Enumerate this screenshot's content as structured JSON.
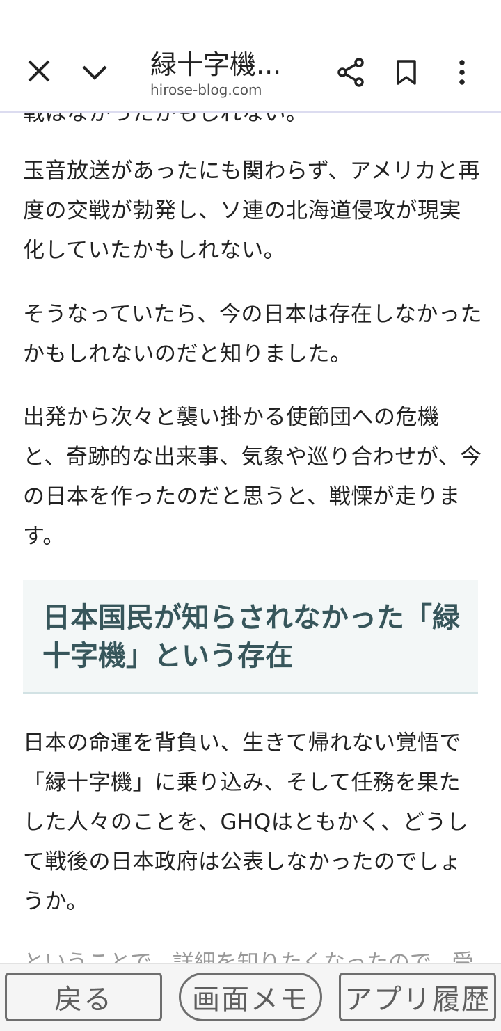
{
  "toolbar": {
    "title": "緑十字機...",
    "url": "hirose-blog.com",
    "icons": [
      "close-icon",
      "chevron-down-icon",
      "share-icon",
      "bookmark-icon",
      "more-vert-icon"
    ]
  },
  "article": {
    "top_fragment": "戦はなかったかもしれない。",
    "paragraphs": [
      "玉音放送があったにも関わらず、アメリカと再度の交戦が勃発し、ソ連の北海道侵攻が現実化していたかもしれない。",
      "そうなっていたら、今の日本は存在しなかったかもしれないのだと知りました。",
      "出発から次々と襲い掛かる使節団への危機と、奇跡的な出来事、気象や巡り合わせが、今の日本を作ったのだと思うと、戦慄が走ります。"
    ],
    "heading": "日本国民が知らされなかった「緑十字機」という存在",
    "paragraph_after": "日本の命運を背負い、生きて帰れない覚悟で「緑十字機」に乗り込み、そして任務を果たした人々のことを、GHQはともかく、どうして戦後の日本政府は公表しなかったのでしょうか。",
    "bottom_fragment": "ということで、詳細を知りたくなったので、受"
  },
  "bottom_buttons": {
    "back": "戻る",
    "screen_memo": "画面メモ",
    "app_history": "アプリ履歴"
  },
  "colors": {
    "heading_text": "#37565b",
    "heading_bg": "#f3f7f7",
    "divider": "#dcdcf0"
  }
}
